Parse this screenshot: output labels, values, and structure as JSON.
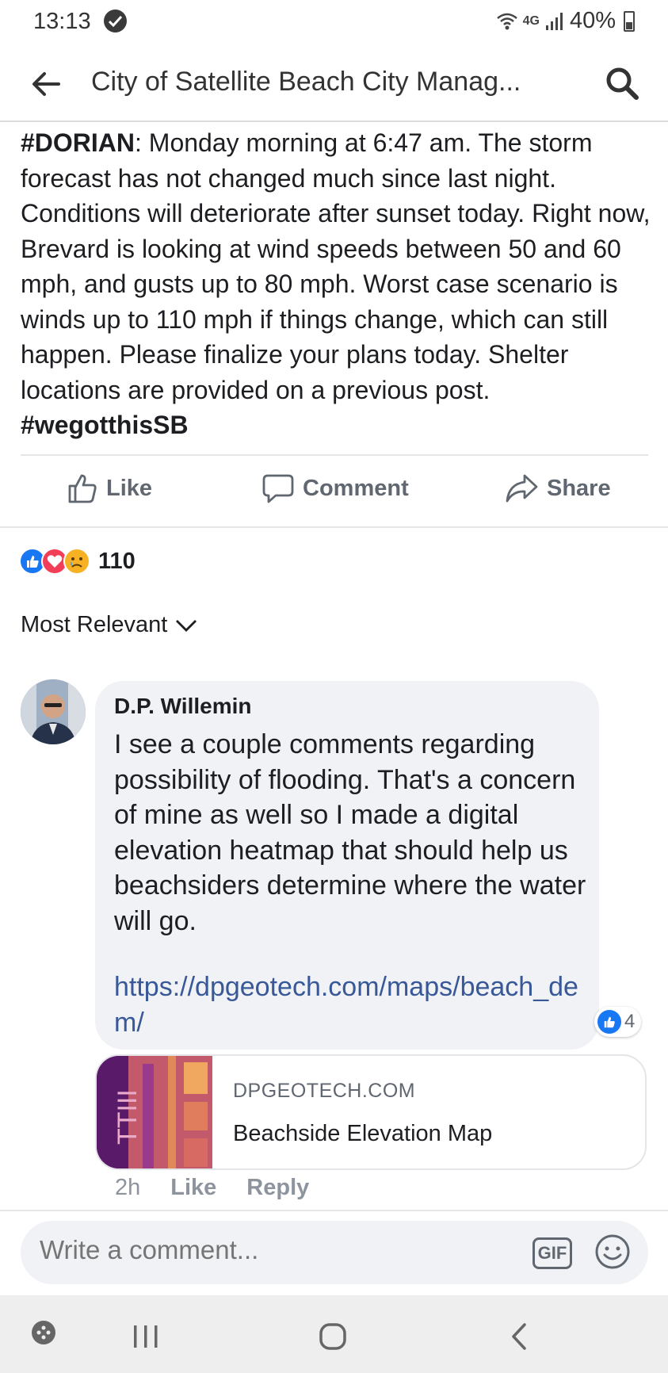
{
  "status_bar": {
    "time": "13:13",
    "network": "4G",
    "battery": "40%"
  },
  "header": {
    "title": "City of Satellite Beach City Manag..."
  },
  "post": {
    "tag_dorian": "#DORIAN",
    "text": ": Monday morning at 6:47 am. The storm forecast has not changed much since last night. Conditions will deteriorate after sunset today. Right now, Brevard is looking at wind speeds between 50 and 60 mph, and gusts up to 80 mph. Worst case scenario is winds up to 110 mph if things change, which can still happen. Please finalize your plans today. Shelter locations are provided on a previous post. ",
    "tag_end": "#wegotthisSB"
  },
  "actions": {
    "like": "Like",
    "comment": "Comment",
    "share": "Share"
  },
  "reactions": {
    "count": "110"
  },
  "sort": {
    "label": "Most Relevant"
  },
  "comment": {
    "author": "D.P. Willemin",
    "text": "I see a couple comments regarding possibility of flooding. That's a concern of mine as well so I made a digital elevation heatmap that should help us beachsiders determine where the water will go.",
    "link": "https://dpgeotech.com/maps/beach_dem/",
    "likes": "4",
    "preview": {
      "domain": "DPGEOTECH.COM",
      "title": "Beachside Elevation Map"
    },
    "meta": {
      "time": "2h",
      "like": "Like",
      "reply": "Reply"
    }
  },
  "composer": {
    "placeholder": "Write a comment...",
    "gif": "GIF"
  },
  "colors": {
    "link": "#385898",
    "like_blue": "#1877f2",
    "love_red": "#f33e58",
    "sad_yellow": "#f7b125"
  }
}
